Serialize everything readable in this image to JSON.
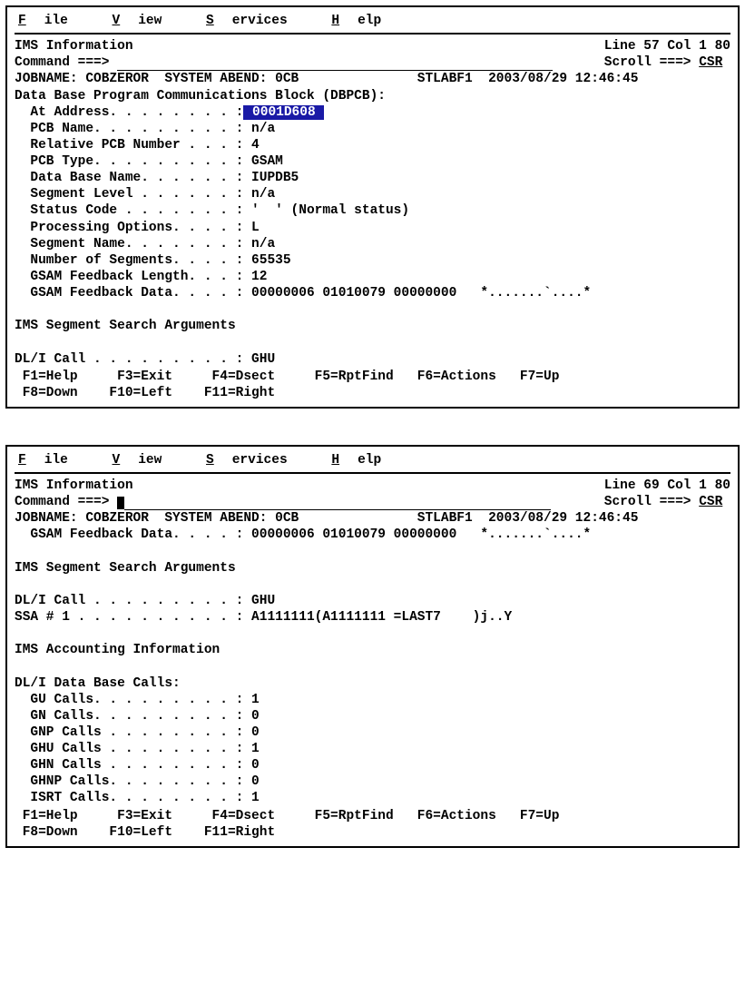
{
  "menu": {
    "file": "File",
    "view": "View",
    "services": "Services",
    "help": "Help"
  },
  "screen1": {
    "title": "IMS Information",
    "pos": "Line 57 Col 1 80",
    "cmd_label": "Command ===>",
    "scroll_label": "Scroll ===>",
    "scroll_value": "CSR",
    "jobline": "JOBNAME: COBZEROR  SYSTEM ABEND: 0CB               STLABF1  2003/08/29 12:46:45",
    "hdr": "Data Base Program Communications Block (DBPCB):",
    "addr_label": "  At Address. . . . . . . . :",
    "addr_value": " 0001D608 ",
    "lines": [
      "  PCB Name. . . . . . . . . : n/a",
      "  Relative PCB Number . . . : 4",
      "  PCB Type. . . . . . . . . : GSAM",
      "  Data Base Name. . . . . . : IUPDB5",
      "  Segment Level . . . . . . : n/a",
      "  Status Code . . . . . . . : '  ' (Normal status)",
      "  Processing Options. . . . : L",
      "  Segment Name. . . . . . . : n/a",
      "  Number of Segments. . . . : 65535",
      "  GSAM Feedback Length. . . : 12",
      "  GSAM Feedback Data. . . . : 00000006 01010079 00000000   *.......`....*",
      "",
      "IMS Segment Search Arguments",
      "",
      "DL/I Call . . . . . . . . . : GHU"
    ],
    "fkeys1": " F1=Help     F3=Exit     F4=Dsect     F5=RptFind   F6=Actions   F7=Up",
    "fkeys2": " F8=Down    F10=Left    F11=Right"
  },
  "screen2": {
    "title": "IMS Information",
    "pos": "Line 69 Col 1 80",
    "cmd_label": "Command ===>",
    "scroll_label": "Scroll ===>",
    "scroll_value": "CSR",
    "jobline": "JOBNAME: COBZEROR  SYSTEM ABEND: 0CB               STLABF1  2003/08/29 12:46:45",
    "lines": [
      "  GSAM Feedback Data. . . . : 00000006 01010079 00000000   *.......`....*",
      "",
      "IMS Segment Search Arguments",
      "",
      "DL/I Call . . . . . . . . . : GHU",
      "SSA # 1 . . . . . . . . . . : A1111111(A1111111 =LAST7    )j..Y",
      "",
      "IMS Accounting Information",
      "",
      "DL/I Data Base Calls:",
      "  GU Calls. . . . . . . . . : 1",
      "  GN Calls. . . . . . . . . : 0",
      "  GNP Calls . . . . . . . . : 0",
      "  GHU Calls . . . . . . . . : 1",
      "  GHN Calls . . . . . . . . : 0",
      "  GHNP Calls. . . . . . . . : 0",
      "  ISRT Calls. . . . . . . . : 1"
    ],
    "fkeys1": " F1=Help     F3=Exit     F4=Dsect     F5=RptFind   F6=Actions   F7=Up",
    "fkeys2": " F8=Down    F10=Left    F11=Right"
  }
}
